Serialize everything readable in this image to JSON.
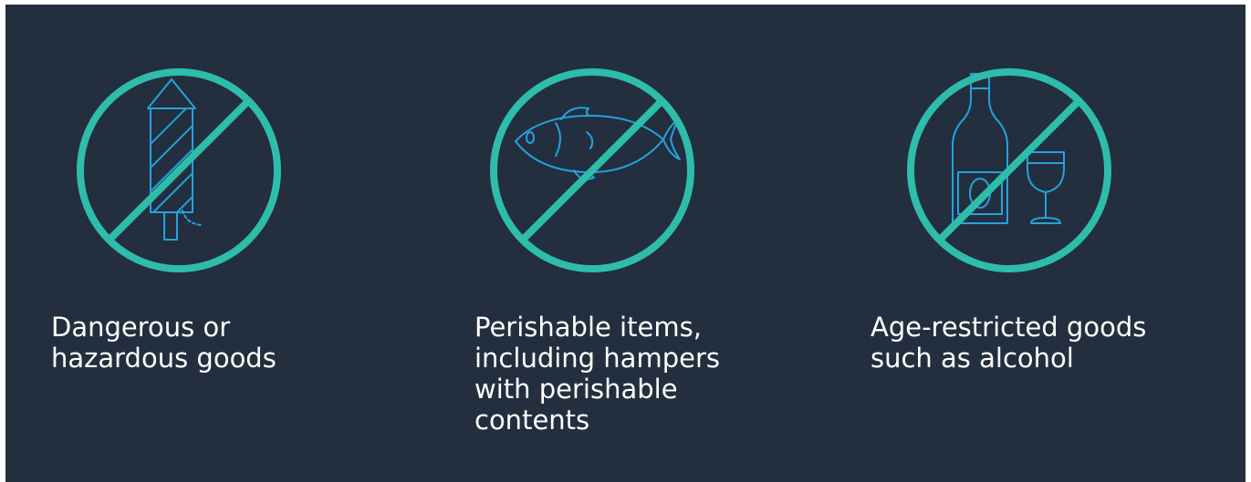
{
  "colors": {
    "background": "#232f3e",
    "ring": "#2ebdaa",
    "icon_stroke": "#22a3e0",
    "text": "#ffffff"
  },
  "items": [
    {
      "icon": "firework-rocket-icon",
      "label": "Dangerous or\nhazardous goods"
    },
    {
      "icon": "fish-icon",
      "label": "Perishable items,\nincluding hampers\nwith perishable\ncontents"
    },
    {
      "icon": "wine-bottle-glass-icon",
      "label": "Age-restricted goods\nsuch as alcohol"
    }
  ]
}
